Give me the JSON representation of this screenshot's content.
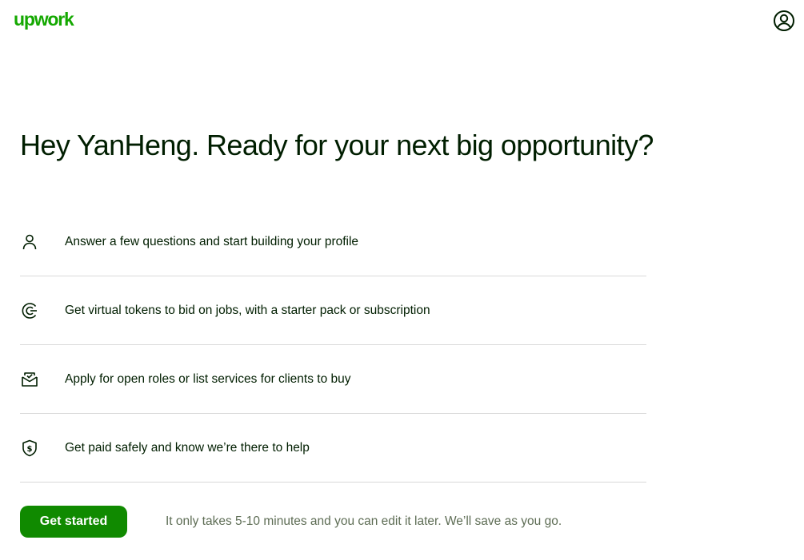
{
  "header": {
    "logo_text": "upwork",
    "account_icon": "user-circle-icon"
  },
  "main": {
    "headline": "Hey YanHeng. Ready for your next big opportunity?",
    "steps": [
      {
        "icon": "person-icon",
        "label": "Answer a few questions and start building your profile"
      },
      {
        "icon": "connects-token-icon",
        "label": "Get virtual tokens to bid on jobs, with a starter pack or subscription"
      },
      {
        "icon": "envelope-check-icon",
        "label": "Apply for open roles or list services for clients to buy"
      },
      {
        "icon": "shield-dollar-icon",
        "label": "Get paid safely and know we’re there to help"
      }
    ],
    "cta_label": "Get started",
    "note": "It only takes 5-10 minutes and you can edit it later. We’ll save as you go."
  },
  "colors": {
    "brand": "#14a800",
    "button": "#108a00",
    "text": "#001e00",
    "muted_text": "#5e6d55",
    "divider": "#d9d9d9"
  }
}
